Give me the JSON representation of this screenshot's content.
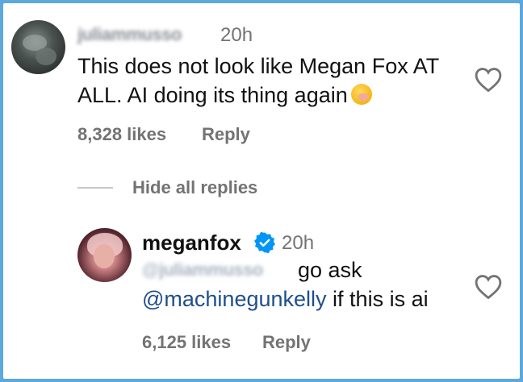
{
  "comment": {
    "username": "juliammusso",
    "time": "20h",
    "text": "This does not look like Megan Fox AT ALL. AI doing its thing again",
    "emoji": "yawning-face-emoji",
    "likes": "8,328 likes",
    "reply_label": "Reply"
  },
  "thread": {
    "hide_replies_label": "Hide all replies"
  },
  "reply": {
    "username": "meganfox",
    "verified": true,
    "time": "20h",
    "mention_blurred": "@juliammusso",
    "text_after_mention": "go ask",
    "mention": "@machinegunkelly",
    "text_end": "if this is ai",
    "likes": "6,125 likes",
    "reply_label": "Reply"
  },
  "colors": {
    "frame": "#5da8dc",
    "verified_badge": "#0095f6",
    "mention": "#1f4e8c",
    "meta": "#737373"
  }
}
